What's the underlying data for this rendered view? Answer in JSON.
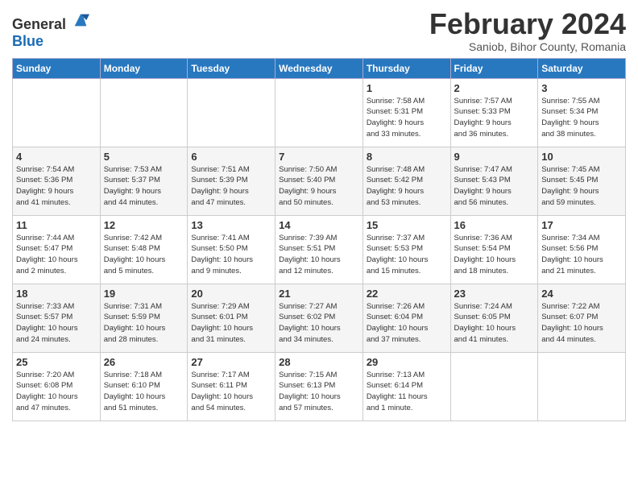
{
  "header": {
    "logo_general": "General",
    "logo_blue": "Blue",
    "title": "February 2024",
    "subtitle": "Saniob, Bihor County, Romania"
  },
  "calendar": {
    "days_of_week": [
      "Sunday",
      "Monday",
      "Tuesday",
      "Wednesday",
      "Thursday",
      "Friday",
      "Saturday"
    ],
    "weeks": [
      [
        {
          "day": "",
          "info": ""
        },
        {
          "day": "",
          "info": ""
        },
        {
          "day": "",
          "info": ""
        },
        {
          "day": "",
          "info": ""
        },
        {
          "day": "1",
          "info": "Sunrise: 7:58 AM\nSunset: 5:31 PM\nDaylight: 9 hours\nand 33 minutes."
        },
        {
          "day": "2",
          "info": "Sunrise: 7:57 AM\nSunset: 5:33 PM\nDaylight: 9 hours\nand 36 minutes."
        },
        {
          "day": "3",
          "info": "Sunrise: 7:55 AM\nSunset: 5:34 PM\nDaylight: 9 hours\nand 38 minutes."
        }
      ],
      [
        {
          "day": "4",
          "info": "Sunrise: 7:54 AM\nSunset: 5:36 PM\nDaylight: 9 hours\nand 41 minutes."
        },
        {
          "day": "5",
          "info": "Sunrise: 7:53 AM\nSunset: 5:37 PM\nDaylight: 9 hours\nand 44 minutes."
        },
        {
          "day": "6",
          "info": "Sunrise: 7:51 AM\nSunset: 5:39 PM\nDaylight: 9 hours\nand 47 minutes."
        },
        {
          "day": "7",
          "info": "Sunrise: 7:50 AM\nSunset: 5:40 PM\nDaylight: 9 hours\nand 50 minutes."
        },
        {
          "day": "8",
          "info": "Sunrise: 7:48 AM\nSunset: 5:42 PM\nDaylight: 9 hours\nand 53 minutes."
        },
        {
          "day": "9",
          "info": "Sunrise: 7:47 AM\nSunset: 5:43 PM\nDaylight: 9 hours\nand 56 minutes."
        },
        {
          "day": "10",
          "info": "Sunrise: 7:45 AM\nSunset: 5:45 PM\nDaylight: 9 hours\nand 59 minutes."
        }
      ],
      [
        {
          "day": "11",
          "info": "Sunrise: 7:44 AM\nSunset: 5:47 PM\nDaylight: 10 hours\nand 2 minutes."
        },
        {
          "day": "12",
          "info": "Sunrise: 7:42 AM\nSunset: 5:48 PM\nDaylight: 10 hours\nand 5 minutes."
        },
        {
          "day": "13",
          "info": "Sunrise: 7:41 AM\nSunset: 5:50 PM\nDaylight: 10 hours\nand 9 minutes."
        },
        {
          "day": "14",
          "info": "Sunrise: 7:39 AM\nSunset: 5:51 PM\nDaylight: 10 hours\nand 12 minutes."
        },
        {
          "day": "15",
          "info": "Sunrise: 7:37 AM\nSunset: 5:53 PM\nDaylight: 10 hours\nand 15 minutes."
        },
        {
          "day": "16",
          "info": "Sunrise: 7:36 AM\nSunset: 5:54 PM\nDaylight: 10 hours\nand 18 minutes."
        },
        {
          "day": "17",
          "info": "Sunrise: 7:34 AM\nSunset: 5:56 PM\nDaylight: 10 hours\nand 21 minutes."
        }
      ],
      [
        {
          "day": "18",
          "info": "Sunrise: 7:33 AM\nSunset: 5:57 PM\nDaylight: 10 hours\nand 24 minutes."
        },
        {
          "day": "19",
          "info": "Sunrise: 7:31 AM\nSunset: 5:59 PM\nDaylight: 10 hours\nand 28 minutes."
        },
        {
          "day": "20",
          "info": "Sunrise: 7:29 AM\nSunset: 6:01 PM\nDaylight: 10 hours\nand 31 minutes."
        },
        {
          "day": "21",
          "info": "Sunrise: 7:27 AM\nSunset: 6:02 PM\nDaylight: 10 hours\nand 34 minutes."
        },
        {
          "day": "22",
          "info": "Sunrise: 7:26 AM\nSunset: 6:04 PM\nDaylight: 10 hours\nand 37 minutes."
        },
        {
          "day": "23",
          "info": "Sunrise: 7:24 AM\nSunset: 6:05 PM\nDaylight: 10 hours\nand 41 minutes."
        },
        {
          "day": "24",
          "info": "Sunrise: 7:22 AM\nSunset: 6:07 PM\nDaylight: 10 hours\nand 44 minutes."
        }
      ],
      [
        {
          "day": "25",
          "info": "Sunrise: 7:20 AM\nSunset: 6:08 PM\nDaylight: 10 hours\nand 47 minutes."
        },
        {
          "day": "26",
          "info": "Sunrise: 7:18 AM\nSunset: 6:10 PM\nDaylight: 10 hours\nand 51 minutes."
        },
        {
          "day": "27",
          "info": "Sunrise: 7:17 AM\nSunset: 6:11 PM\nDaylight: 10 hours\nand 54 minutes."
        },
        {
          "day": "28",
          "info": "Sunrise: 7:15 AM\nSunset: 6:13 PM\nDaylight: 10 hours\nand 57 minutes."
        },
        {
          "day": "29",
          "info": "Sunrise: 7:13 AM\nSunset: 6:14 PM\nDaylight: 11 hours\nand 1 minute."
        },
        {
          "day": "",
          "info": ""
        },
        {
          "day": "",
          "info": ""
        }
      ]
    ]
  }
}
